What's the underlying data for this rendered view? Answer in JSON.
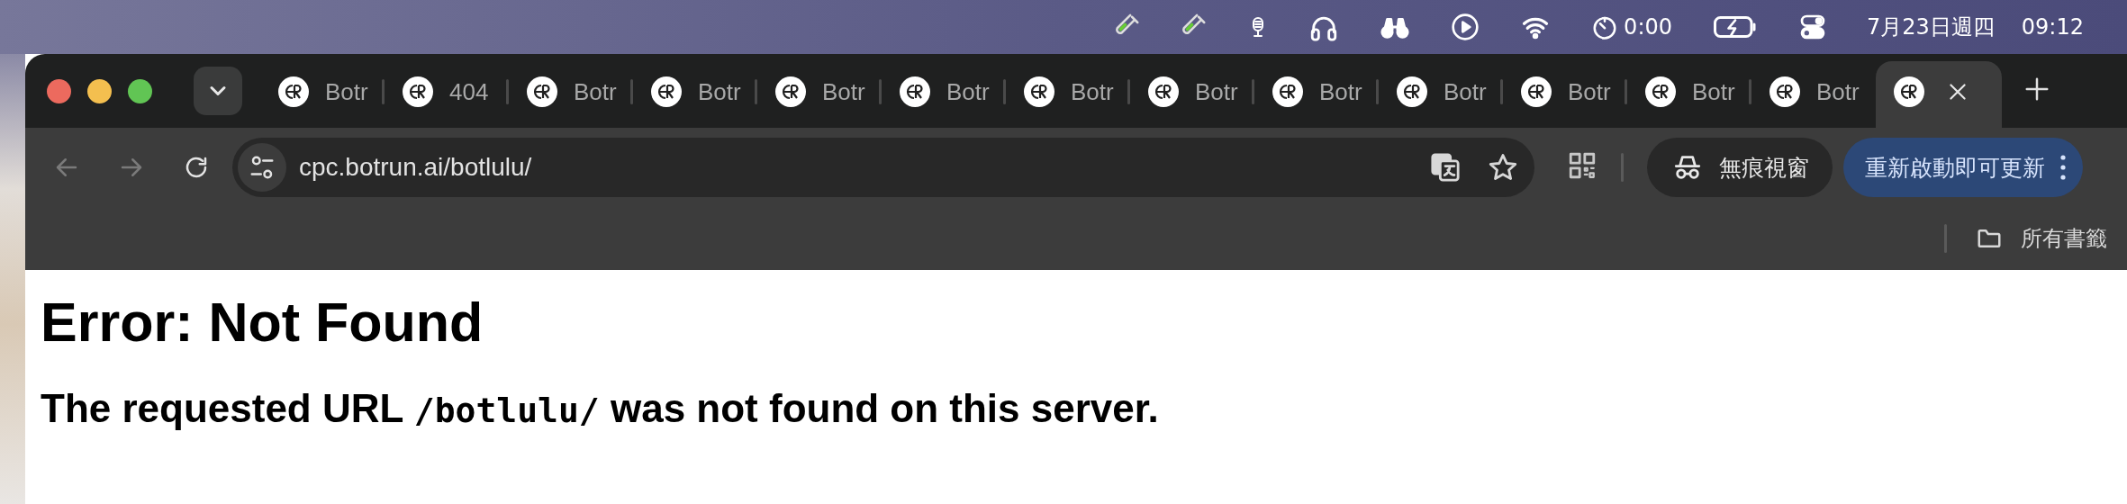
{
  "menu_bar": {
    "timer": "0:00",
    "date": "7月23日週四",
    "time": "09:12"
  },
  "tabs": [
    {
      "title": "Botr",
      "selected": false
    },
    {
      "title": "404",
      "selected": false
    },
    {
      "title": "Botr",
      "selected": false
    },
    {
      "title": "Botr",
      "selected": false
    },
    {
      "title": "Botr",
      "selected": false
    },
    {
      "title": "Botr",
      "selected": false
    },
    {
      "title": "Botr",
      "selected": false
    },
    {
      "title": "Botr",
      "selected": false
    },
    {
      "title": "Botr",
      "selected": false
    },
    {
      "title": "Botr",
      "selected": false
    },
    {
      "title": "Botr",
      "selected": false
    },
    {
      "title": "Botr",
      "selected": false
    },
    {
      "title": "Botr",
      "selected": false
    },
    {
      "selected": true
    }
  ],
  "toolbar": {
    "nav": [
      {
        "kind": "back",
        "disabled": true
      },
      {
        "kind": "forward",
        "disabled": true
      },
      {
        "kind": "reload",
        "disabled": false
      }
    ],
    "url": "cpc.botrun.ai/botlulu/",
    "incognito_label": "無痕視窗",
    "update_button": "重新啟動即可更新"
  },
  "bookmarks_bar": {
    "all_bookmarks": "所有書籤"
  },
  "page": {
    "heading": "Error: Not Found",
    "message": {
      "before": "The requested URL ",
      "code": "/botlulu/",
      "after": " was not found on this server."
    }
  }
}
